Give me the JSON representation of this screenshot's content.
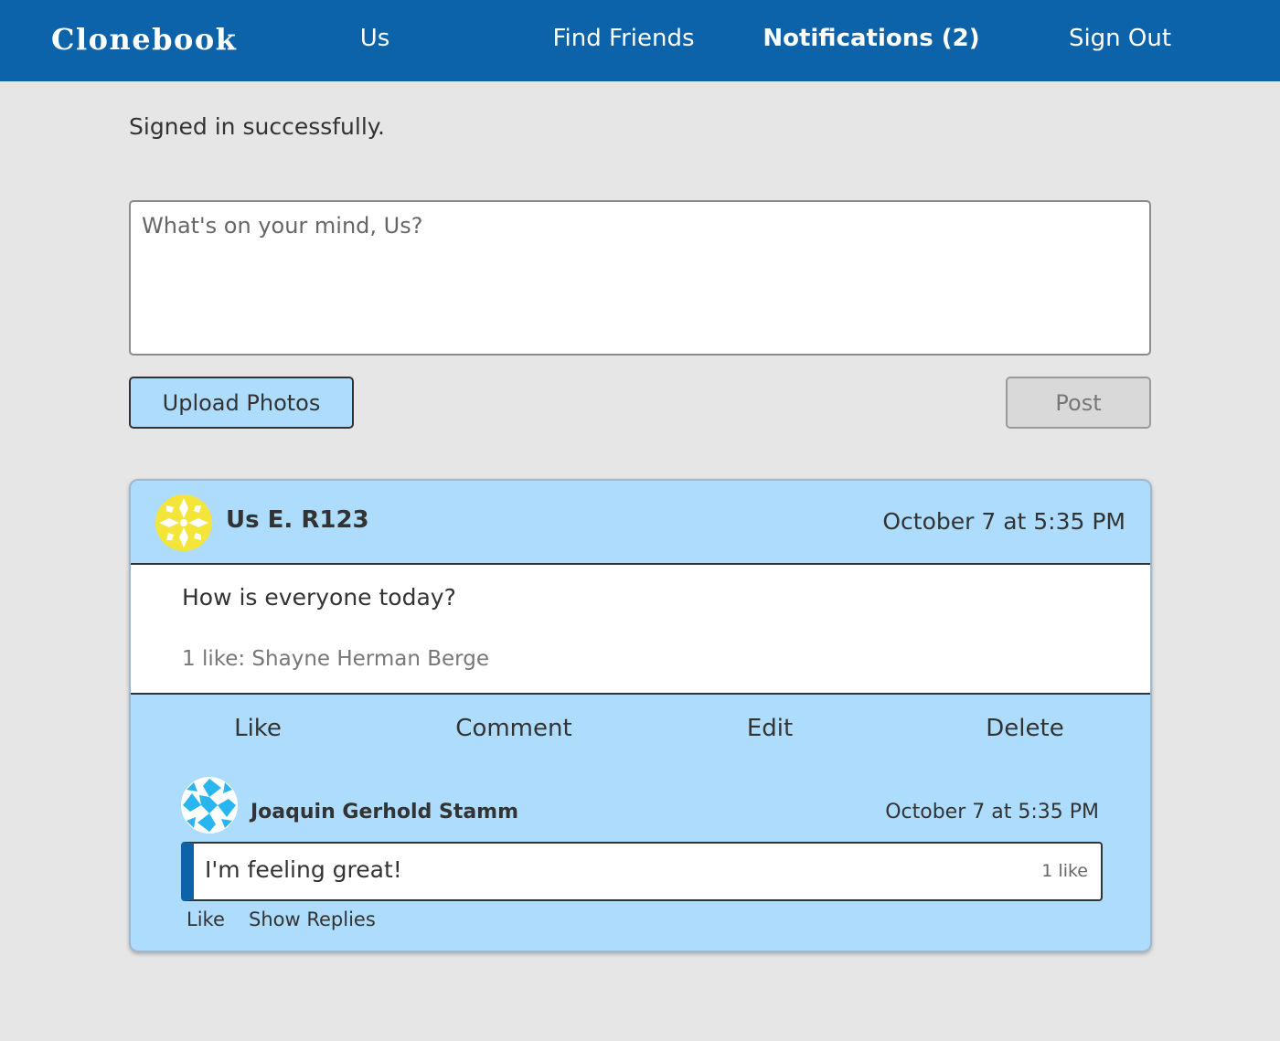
{
  "nav": {
    "brand": "Clonebook",
    "links": [
      "Us",
      "Find Friends",
      "Notifications (2)",
      "Sign Out"
    ],
    "brand_color": "#0c63aa"
  },
  "flash": "Signed in successfully.",
  "composer": {
    "placeholder": "What's on your mind, Us?",
    "upload_label": "Upload Photos",
    "post_label": "Post"
  },
  "post": {
    "author": "Us E. R123",
    "date": "October 7 at 5:35 PM",
    "text": "How is everyone today?",
    "likes": "1 like: Shayne Herman Berge",
    "actions": [
      "Like",
      "Comment",
      "Edit",
      "Delete"
    ],
    "card_color": "#aedcfd",
    "comment": {
      "author": "Joaquin Gerhold Stamm",
      "date": "October 7 at 5:35 PM",
      "text": "I'm feeling great!",
      "likes": "1 like",
      "actions": [
        "Like",
        "Show Replies"
      ]
    }
  }
}
